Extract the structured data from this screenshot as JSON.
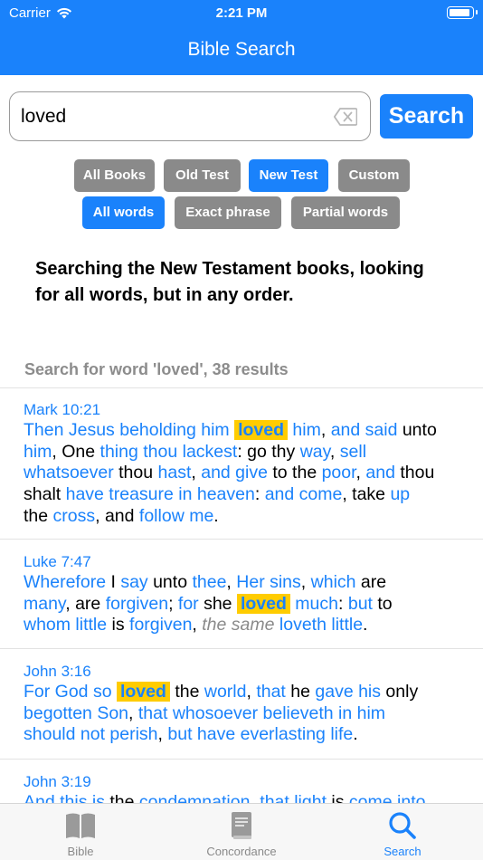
{
  "status_bar": {
    "carrier": "Carrier",
    "time": "2:21 PM"
  },
  "nav": {
    "title": "Bible Search"
  },
  "search": {
    "value": "loved",
    "placeholder": "",
    "button_label": "Search"
  },
  "scope_filters": [
    {
      "label": "All Books",
      "selected": false
    },
    {
      "label": "Old Test",
      "selected": false
    },
    {
      "label": "New Test",
      "selected": true
    },
    {
      "label": "Custom",
      "selected": false
    }
  ],
  "match_filters": [
    {
      "label": "All words",
      "selected": true
    },
    {
      "label": "Exact phrase",
      "selected": false
    },
    {
      "label": "Partial words",
      "selected": false
    }
  ],
  "description": "Searching the New Testament books, looking for all words, but in any order.",
  "results_header": "Search for word 'loved', 38 results",
  "results": [
    {
      "reference": "Mark 10:21",
      "lines": [
        [
          [
            "w",
            "Then Jesus beholding him"
          ],
          [
            "t",
            " "
          ],
          [
            "hl",
            "loved"
          ],
          [
            "w",
            " him"
          ],
          [
            "t",
            ", "
          ],
          [
            "w",
            "and said"
          ],
          [
            "t",
            " unto"
          ]
        ],
        [
          [
            "w",
            "him"
          ],
          [
            "t",
            ", One "
          ],
          [
            "w",
            "thing thou lackest"
          ],
          [
            "t",
            ": go thy "
          ],
          [
            "w",
            "way"
          ],
          [
            "t",
            ", "
          ],
          [
            "w",
            "sell"
          ]
        ],
        [
          [
            "w",
            "whatsoever"
          ],
          [
            "t",
            " thou "
          ],
          [
            "w",
            "hast"
          ],
          [
            "t",
            ", "
          ],
          [
            "w",
            "and give"
          ],
          [
            "t",
            " to the "
          ],
          [
            "w",
            "poor"
          ],
          [
            "t",
            ", "
          ],
          [
            "w",
            "and"
          ],
          [
            "t",
            " thou"
          ]
        ],
        [
          [
            "t",
            "shalt "
          ],
          [
            "w",
            "have treasure in heaven"
          ],
          [
            "t",
            ": "
          ],
          [
            "w",
            "and come"
          ],
          [
            "t",
            ", take "
          ],
          [
            "w",
            "up"
          ]
        ],
        [
          [
            "t",
            "the "
          ],
          [
            "w",
            "cross"
          ],
          [
            "t",
            ", and "
          ],
          [
            "w",
            "follow me"
          ],
          [
            "t",
            "."
          ]
        ]
      ]
    },
    {
      "reference": "Luke 7:47",
      "lines": [
        [
          [
            "w",
            "Wherefore"
          ],
          [
            "t",
            " I "
          ],
          [
            "w",
            "say"
          ],
          [
            "t",
            " unto "
          ],
          [
            "w",
            "thee"
          ],
          [
            "t",
            ", "
          ],
          [
            "w",
            "Her sins"
          ],
          [
            "t",
            ", "
          ],
          [
            "w",
            "which"
          ],
          [
            "t",
            " are"
          ]
        ],
        [
          [
            "w",
            "many"
          ],
          [
            "t",
            ", are "
          ],
          [
            "w",
            "forgiven"
          ],
          [
            "t",
            "; "
          ],
          [
            "w",
            "for"
          ],
          [
            "t",
            " she "
          ],
          [
            "hl",
            "loved"
          ],
          [
            "w",
            " much"
          ],
          [
            "t",
            ": "
          ],
          [
            "w",
            "but"
          ],
          [
            "t",
            " to"
          ]
        ],
        [
          [
            "w",
            "whom little"
          ],
          [
            "t",
            " is "
          ],
          [
            "w",
            "forgiven"
          ],
          [
            "t",
            ", "
          ],
          [
            "it",
            "the same"
          ],
          [
            "t",
            " "
          ],
          [
            "w",
            "loveth little"
          ],
          [
            "t",
            "."
          ]
        ]
      ]
    },
    {
      "reference": "John 3:16",
      "lines": [
        [
          [
            "w",
            "For God so"
          ],
          [
            "t",
            " "
          ],
          [
            "hl",
            "loved"
          ],
          [
            "t",
            " the "
          ],
          [
            "w",
            "world"
          ],
          [
            "t",
            ", "
          ],
          [
            "w",
            "that"
          ],
          [
            "t",
            " he "
          ],
          [
            "w",
            "gave his"
          ],
          [
            "t",
            " only"
          ]
        ],
        [
          [
            "w",
            "begotten Son"
          ],
          [
            "t",
            ", "
          ],
          [
            "w",
            "that whosoever believeth in him"
          ]
        ],
        [
          [
            "w",
            "should not perish"
          ],
          [
            "t",
            ", "
          ],
          [
            "w",
            "but have everlasting life"
          ],
          [
            "t",
            "."
          ]
        ]
      ]
    },
    {
      "reference": "John 3:19",
      "lines": [
        [
          [
            "w",
            "And this is"
          ],
          [
            "t",
            " the "
          ],
          [
            "w",
            "condemnation"
          ],
          [
            "t",
            ", "
          ],
          [
            "w",
            "that light"
          ],
          [
            "t",
            " is "
          ],
          [
            "w",
            "come into"
          ]
        ]
      ]
    }
  ],
  "tabs": [
    {
      "label": "Bible",
      "icon": "book-icon",
      "active": false
    },
    {
      "label": "Concordance",
      "icon": "concordance-icon",
      "active": false
    },
    {
      "label": "Search",
      "icon": "search-icon",
      "active": true
    }
  ],
  "colors": {
    "accent": "#1a82fb",
    "highlight": "#ffcc00",
    "chip_inactive": "#8a8a8a"
  }
}
